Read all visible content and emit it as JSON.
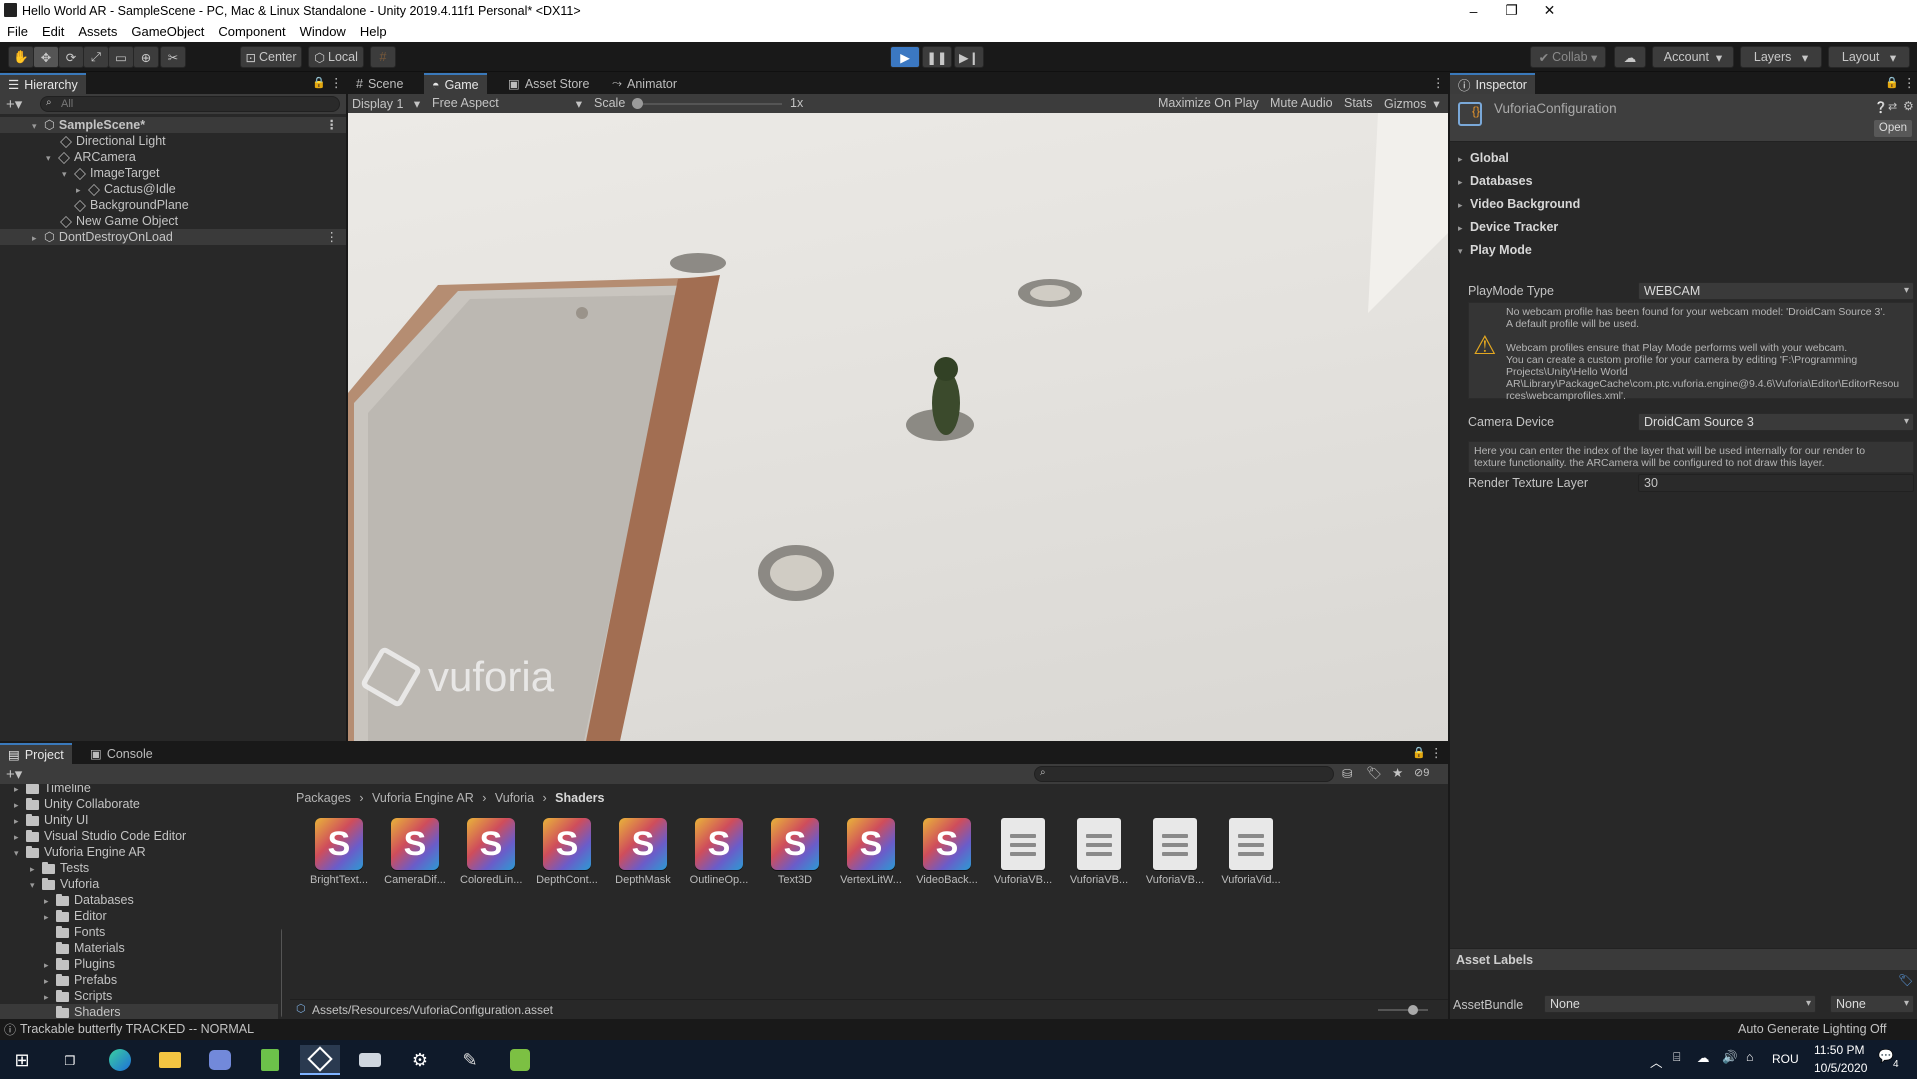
{
  "window": {
    "title": "Hello World AR - SampleScene - PC, Mac & Linux Standalone - Unity 2019.4.11f1 Personal* <DX11>",
    "minimize": "–",
    "maximize": "❐",
    "close": "✕"
  },
  "menu": [
    "File",
    "Edit",
    "Assets",
    "GameObject",
    "Component",
    "Window",
    "Help"
  ],
  "toolbar": {
    "pivot": "Center",
    "space": "Local",
    "collab": "Collab",
    "account": "Account",
    "layers": "Layers",
    "layout": "Layout"
  },
  "hierarchy": {
    "tab": "Hierarchy",
    "search_placeholder": "All",
    "items": [
      {
        "label": "SampleScene*",
        "depth": 0
      },
      {
        "label": "Directional Light",
        "depth": 1
      },
      {
        "label": "ARCamera",
        "depth": 1
      },
      {
        "label": "ImageTarget",
        "depth": 2
      },
      {
        "label": "Cactus@Idle",
        "depth": 3
      },
      {
        "label": "BackgroundPlane",
        "depth": 2
      },
      {
        "label": "New Game Object",
        "depth": 1
      },
      {
        "label": "DontDestroyOnLoad",
        "depth": 0
      }
    ]
  },
  "center_tabs": [
    "Scene",
    "Game",
    "Asset Store",
    "Animator"
  ],
  "game_bar": {
    "display": "Display 1",
    "aspect": "Free Aspect",
    "scale_label": "Scale",
    "scale_value": "1x",
    "maximize": "Maximize On Play",
    "mute": "Mute Audio",
    "stats": "Stats",
    "gizmos": "Gizmos"
  },
  "game_view": {
    "watermark": "vuforia"
  },
  "inspector": {
    "tab": "Inspector",
    "object": "VuforiaConfiguration",
    "open_btn": "Open",
    "sections": [
      "Global",
      "Databases",
      "Video Background",
      "Device Tracker",
      "Play Mode"
    ],
    "playmode_type_label": "PlayMode Type",
    "playmode_type_value": "WEBCAM",
    "help1": [
      "No webcam profile has been found for your webcam model: 'DroidCam Source 3'.",
      "A default profile will be used."
    ],
    "help2": [
      "Webcam profiles ensure that Play Mode performs well with your webcam.",
      "You can create a custom profile for your camera by editing 'F:\\Programming",
      "Projects\\Unity\\Hello World",
      "AR\\Library\\PackageCache\\com.ptc.vuforia.engine@9.4.6\\Vuforia\\Editor\\EditorResou",
      "rces\\webcamprofiles.xml'."
    ],
    "camera_device_label": "Camera Device",
    "camera_device_value": "DroidCam Source 3",
    "help3": [
      "Here you can enter the index of the layer that will be used internally for our render to",
      "texture functionality. the ARCamera will be configured to not draw this layer."
    ],
    "render_layer_label": "Render Texture Layer",
    "render_layer_value": "30",
    "asset_labels": "Asset Labels",
    "asset_bundle_label": "AssetBundle",
    "asset_bundle_value": "None",
    "asset_bundle_variant": "None"
  },
  "project": {
    "tabs": [
      "Project",
      "Console"
    ],
    "hidden_count": "9",
    "tree": [
      {
        "label": "Timeline",
        "depth": 1,
        "fold": "▸"
      },
      {
        "label": "Unity Collaborate",
        "depth": 1,
        "fold": "▸"
      },
      {
        "label": "Unity UI",
        "depth": 1,
        "fold": "▸"
      },
      {
        "label": "Visual Studio Code Editor",
        "depth": 1,
        "fold": "▸"
      },
      {
        "label": "Vuforia Engine AR",
        "depth": 1,
        "fold": "▾"
      },
      {
        "label": "Tests",
        "depth": 2,
        "fold": "▸"
      },
      {
        "label": "Vuforia",
        "depth": 2,
        "fold": "▾"
      },
      {
        "label": "Databases",
        "depth": 3,
        "fold": "▸"
      },
      {
        "label": "Editor",
        "depth": 3,
        "fold": "▸"
      },
      {
        "label": "Fonts",
        "depth": 3,
        "fold": ""
      },
      {
        "label": "Materials",
        "depth": 3,
        "fold": ""
      },
      {
        "label": "Plugins",
        "depth": 3,
        "fold": "▸"
      },
      {
        "label": "Prefabs",
        "depth": 3,
        "fold": "▸"
      },
      {
        "label": "Scripts",
        "depth": 3,
        "fold": "▸"
      },
      {
        "label": "Shaders",
        "depth": 3,
        "fold": ""
      }
    ],
    "breadcrumb": [
      "Packages",
      "Vuforia Engine AR",
      "Vuforia",
      "Shaders"
    ],
    "assets": [
      {
        "label": "BrightText...",
        "kind": "shader"
      },
      {
        "label": "CameraDif...",
        "kind": "shader"
      },
      {
        "label": "ColoredLin...",
        "kind": "shader"
      },
      {
        "label": "DepthCont...",
        "kind": "shader"
      },
      {
        "label": "DepthMask",
        "kind": "shader"
      },
      {
        "label": "OutlineOp...",
        "kind": "shader"
      },
      {
        "label": "Text3D",
        "kind": "shader"
      },
      {
        "label": "VertexLitW...",
        "kind": "shader"
      },
      {
        "label": "VideoBack...",
        "kind": "shader"
      },
      {
        "label": "VuforiaVB...",
        "kind": "doc"
      },
      {
        "label": "VuforiaVB...",
        "kind": "doc"
      },
      {
        "label": "VuforiaVB...",
        "kind": "doc"
      },
      {
        "label": "VuforiaVid...",
        "kind": "doc"
      }
    ],
    "selected_path": "Assets/Resources/VuforiaConfiguration.asset"
  },
  "status": {
    "message": "Trackable butterfly TRACKED -- NORMAL",
    "right": "Auto Generate Lighting Off"
  },
  "taskbar": {
    "lang": "ROU",
    "time": "11:50 PM",
    "date": "10/5/2020",
    "notif_count": "4"
  }
}
